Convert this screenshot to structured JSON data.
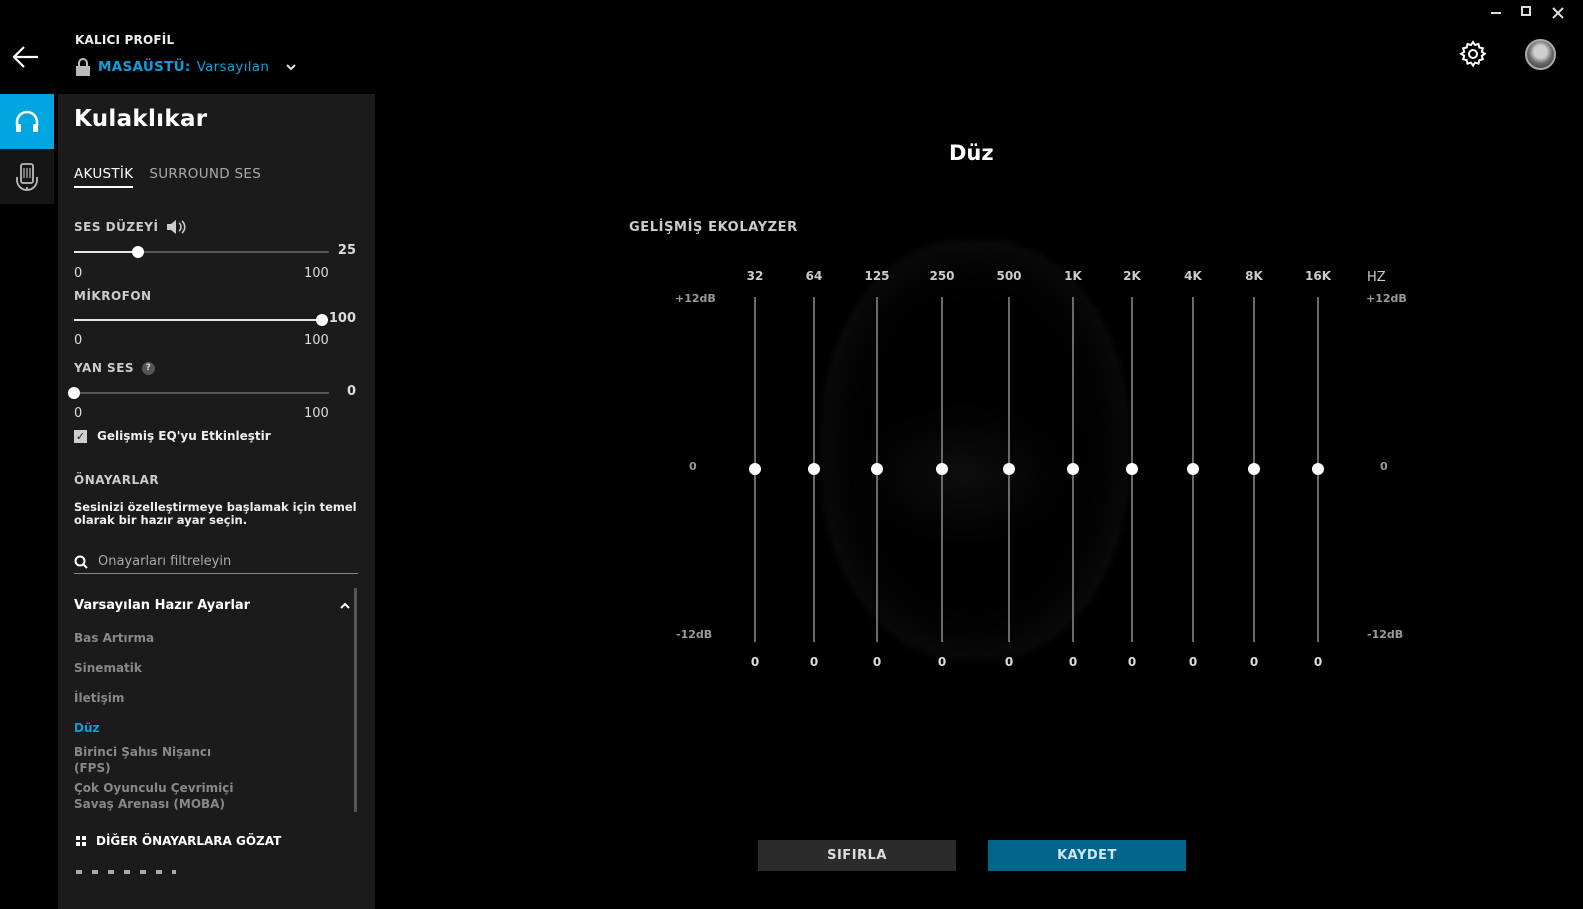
{
  "header": {
    "profile_label": "KALICI PROFİL",
    "profile_key": "MASAÜSTÜ:",
    "profile_value": "Varsayılan"
  },
  "panel": {
    "title": "Kulaklıkar",
    "tabs": [
      {
        "label": "AKUSTİK",
        "active": true
      },
      {
        "label": "SURROUND SES",
        "active": false
      }
    ],
    "volume": {
      "label": "SES DÜZEYİ",
      "value": "25",
      "min": "0",
      "max": "100",
      "level": 25
    },
    "mic": {
      "label": "MİKROFON",
      "value": "100",
      "min": "0",
      "max": "100",
      "level": 100
    },
    "sidetone": {
      "label": "YAN SES",
      "value": "0",
      "min": "0",
      "max": "100",
      "level": 0,
      "help": "?"
    },
    "advanced_eq": {
      "label": "Gelişmiş EQ'yu Etkinleştir",
      "checked": true,
      "mark": "✓"
    },
    "presets": {
      "heading": "ÖNAYARLAR",
      "description": "Sesinizi özelleştirmeye başlamak için temel olarak bir hazır ayar seçin.",
      "search_placeholder": "Önayarları filtreleyin",
      "group_title": "Varsayılan Hazır Ayarlar",
      "items": [
        "Bas Artırma",
        "Sinematik",
        "İletişim",
        "Düz",
        "Birinci Şahıs Nişancı (FPS)",
        "Çok Oyunculu Çevrimiçi Savaş Arenası (MOBA)"
      ],
      "active_item": "Düz",
      "browse_label": "DİĞER ÖNAYARLARA GÖZAT"
    }
  },
  "main": {
    "title": "Düz",
    "eq_heading": "GELİŞMİŞ EKOLAYZER",
    "hz_label": "HZ",
    "db_top": "+12dB",
    "db_mid": "0",
    "db_bottom": "-12dB",
    "bands": [
      {
        "freq": "32",
        "gain": 0,
        "display": "0"
      },
      {
        "freq": "64",
        "gain": 0,
        "display": "0"
      },
      {
        "freq": "125",
        "gain": 0,
        "display": "0"
      },
      {
        "freq": "250",
        "gain": 0,
        "display": "0"
      },
      {
        "freq": "500",
        "gain": 0,
        "display": "0"
      },
      {
        "freq": "1K",
        "gain": 0,
        "display": "0"
      },
      {
        "freq": "2K",
        "gain": 0,
        "display": "0"
      },
      {
        "freq": "4K",
        "gain": 0,
        "display": "0"
      },
      {
        "freq": "8K",
        "gain": 0,
        "display": "0"
      },
      {
        "freq": "16K",
        "gain": 0,
        "display": "0"
      }
    ],
    "reset_label": "SIFIRLA",
    "save_label": "KAYDET"
  },
  "colors": {
    "accent": "#00a6e0",
    "save_button": "#01658c",
    "panel_bg": "#1b1b1b"
  }
}
